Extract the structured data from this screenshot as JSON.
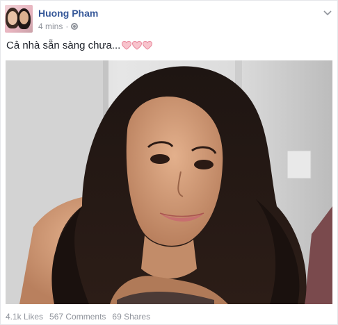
{
  "post": {
    "author": "Huong Pham",
    "time": "4 mins",
    "separator": "·",
    "caption": "Cả nhà sẵn sàng chưa...",
    "caption_hearts": 3,
    "photo_alt": "",
    "stats": {
      "likes": "4.1k Likes",
      "comments": "567 Comments",
      "shares": "69 Shares"
    }
  },
  "icons": {
    "privacy": "globe-icon",
    "menu": "chevron-down-icon",
    "heart": "heart-icon"
  },
  "colors": {
    "link": "#365899",
    "muted": "#90949c",
    "text": "#1d2129",
    "heart": "#f4a6b3"
  }
}
